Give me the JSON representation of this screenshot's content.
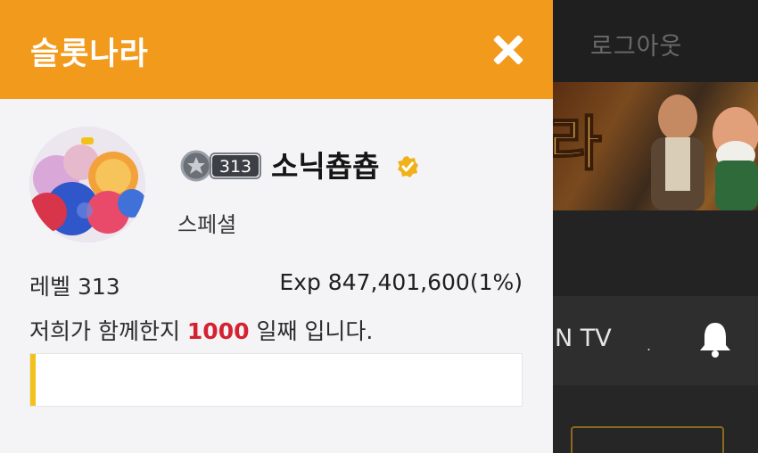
{
  "drawer": {
    "brand": "슬롯나라",
    "close_icon": "close-icon"
  },
  "profile": {
    "avatar_icon": "lollipop-avatar",
    "level_badge": "313",
    "nickname": "소닉춉춉",
    "verified_icon": "verified-badge-icon",
    "grade": "스페셜",
    "level_label": "레벨 313",
    "exp_label": "Exp 847,401,600(1%)",
    "exp_percent": 1,
    "days_prefix": "저희가 함께한지",
    "days_count": "1000",
    "days_suffix": "일째 입니다."
  },
  "background": {
    "logout": "로그아웃",
    "tv": "N TV",
    "dot": ".",
    "bell_icon": "bell-icon"
  },
  "colors": {
    "header": "#f29a1c",
    "accent_red": "#d42230",
    "progress": "#f2c21b"
  }
}
